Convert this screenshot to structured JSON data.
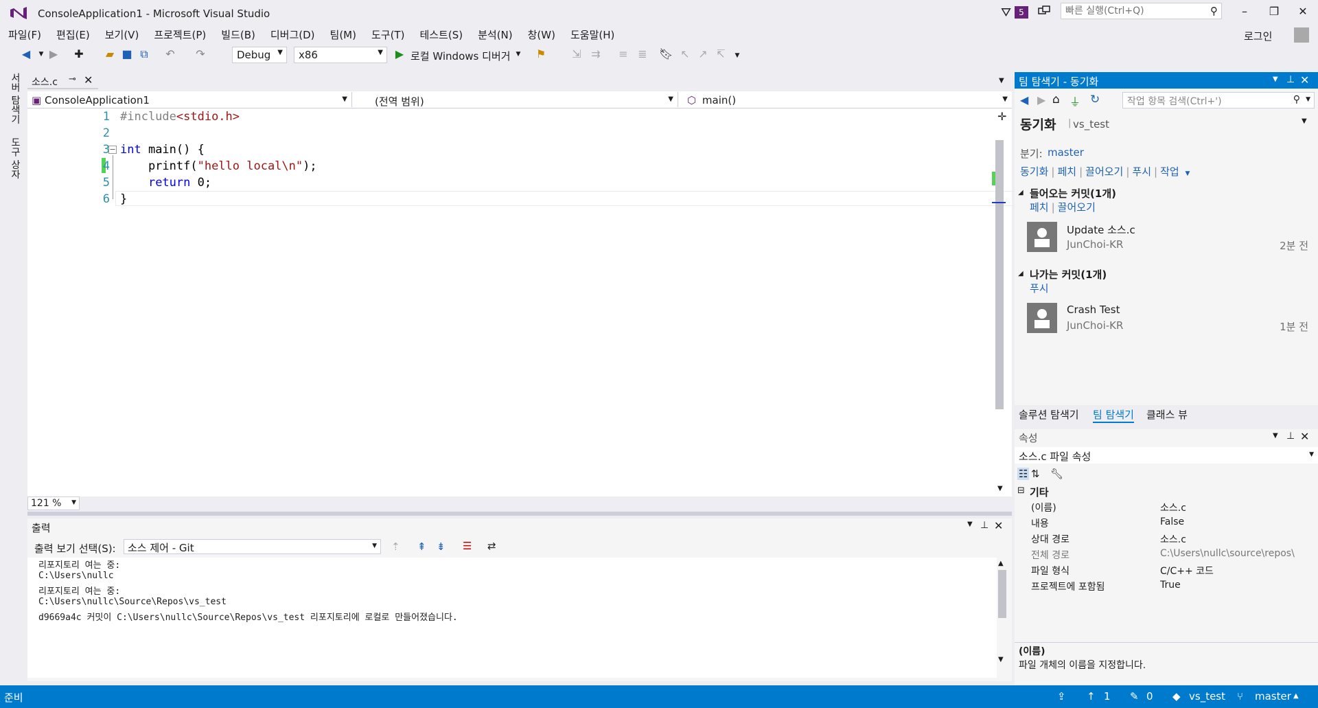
{
  "window": {
    "title": "ConsoleApplication1 - Microsoft Visual Studio",
    "notification_count": "5",
    "quick_launch_placeholder": "빠른 실행(Ctrl+Q)",
    "login": "로그인"
  },
  "menu": [
    "파일(F)",
    "편집(E)",
    "보기(V)",
    "프로젝트(P)",
    "빌드(B)",
    "디버그(D)",
    "팀(M)",
    "도구(T)",
    "테스트(S)",
    "분석(N)",
    "창(W)",
    "도움말(H)"
  ],
  "toolbar": {
    "config": "Debug",
    "platform": "x86",
    "run_label": "로컬 Windows 디버거"
  },
  "left_tabs": [
    "서버 탐색기",
    "도구 상자"
  ],
  "document": {
    "tab_label": "소스.c",
    "nav_project": "ConsoleApplication1",
    "nav_scope": "(전역 범위)",
    "nav_member": "main()",
    "zoom": "121 %",
    "lines": [
      {
        "n": "1",
        "html_parts": [
          [
            "pp",
            "#include"
          ],
          [
            "str",
            "<stdio.h>"
          ]
        ]
      },
      {
        "n": "2",
        "html_parts": []
      },
      {
        "n": "3",
        "html_parts": [
          [
            "kw",
            "int"
          ],
          [
            "",
            " main() {"
          ]
        ]
      },
      {
        "n": "4",
        "html_parts": [
          [
            "",
            "    printf("
          ],
          [
            "str",
            "\"hello local\\n\""
          ],
          [
            "",
            ");"
          ]
        ]
      },
      {
        "n": "5",
        "html_parts": [
          [
            "",
            "    "
          ],
          [
            "kw",
            "return"
          ],
          [
            "",
            " 0;"
          ]
        ]
      },
      {
        "n": "6",
        "html_parts": [
          [
            "",
            "}"
          ]
        ]
      }
    ]
  },
  "output": {
    "title": "출력",
    "show_label": "출력 보기 선택(S):",
    "source": "소스 제어 - Git",
    "lines": [
      "리포지토리 여는 중:",
      "C:\\Users\\nullc",
      "리포지토리 여는 중:",
      "C:\\Users\\nullc\\Source\\Repos\\vs_test",
      "d9669a4c 커밋이 C:\\Users\\nullc\\Source\\Repos\\vs_test 리포지토리에 로컬로 만들어졌습니다."
    ]
  },
  "team_explorer": {
    "title": "팀 탐색기 - 동기화",
    "search_placeholder": "작업 항목 검색(Ctrl+')",
    "page_title": "동기화",
    "repo": "vs_test",
    "branch_label": "분기:",
    "branch": "master",
    "actions": [
      "동기화",
      "페치",
      "끌어오기",
      "푸시",
      "작업"
    ],
    "incoming": {
      "header": "들어오는 커밋(1개)",
      "actions": [
        "페치",
        "끌어오기"
      ],
      "commit": {
        "title": "Update 소스.c",
        "author": "JunChoi-KR",
        "time": "2분 전"
      }
    },
    "outgoing": {
      "header": "나가는 커밋(1개)",
      "actions": [
        "푸시"
      ],
      "commit": {
        "title": "Crash Test",
        "author": "JunChoi-KR",
        "time": "1분 전"
      }
    },
    "bottom_tabs": [
      "솔루션 탐색기",
      "팀 탐색기",
      "클래스 뷰"
    ]
  },
  "properties": {
    "title": "속성",
    "object": "소스.c 파일 속성",
    "category": "기타",
    "rows": [
      {
        "name": "(이름)",
        "value": "소스.c"
      },
      {
        "name": "내용",
        "value": "False"
      },
      {
        "name": "상대 경로",
        "value": "소스.c"
      },
      {
        "name": "전체 경로",
        "value": "C:\\Users\\nullc\\source\\repos\\"
      },
      {
        "name": "파일 형식",
        "value": "C/C++ 코드"
      },
      {
        "name": "프로젝트에 포함됨",
        "value": "True"
      }
    ],
    "desc_title": "(이름)",
    "desc_text": "파일 개체의 이름을 지정합니다."
  },
  "status": {
    "ready": "준비",
    "up_count": "1",
    "edit_count": "0",
    "repo": "vs_test",
    "branch": "master"
  },
  "colors": {
    "accent": "#007ACC",
    "vs_purple": "#68217A",
    "keyword": "#0000FF",
    "string": "#A31515",
    "line_number": "#2B91AF"
  }
}
